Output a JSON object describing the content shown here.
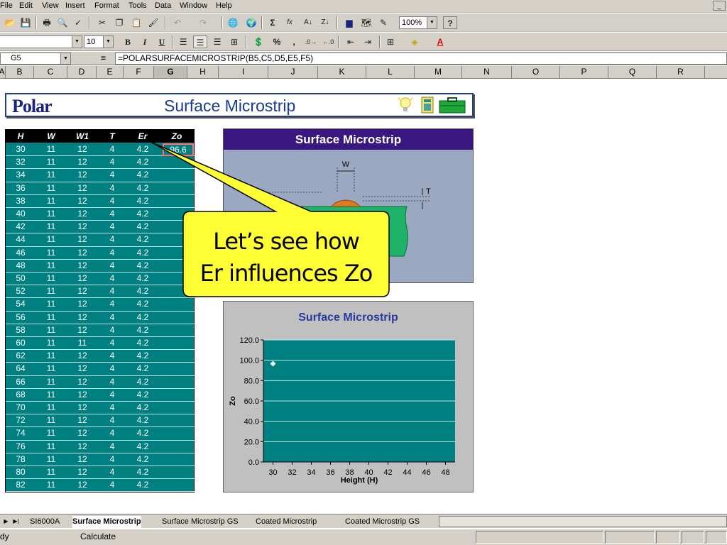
{
  "menu": [
    "File",
    "Edit",
    "View",
    "Insert",
    "Format",
    "Tools",
    "Data",
    "Window",
    "Help"
  ],
  "toolbar": {
    "zoom": "100%",
    "font_size": "10",
    "bold": "B",
    "italic": "I",
    "underline": "U",
    "autosum": "Σ",
    "fx": "fx",
    "percent": "%",
    "comma": ","
  },
  "formula_bar": {
    "cell_ref": "G5",
    "equals": "=",
    "formula": "=POLARSURFACEMICROSTRIP(B5,C5,D5,E5,F5)"
  },
  "columns": [
    "A",
    "B",
    "C",
    "D",
    "E",
    "F",
    "G",
    "H",
    "I",
    "J",
    "K",
    "L",
    "M",
    "N",
    "O",
    "P",
    "Q",
    "R"
  ],
  "selected_column": "G",
  "banner": {
    "logo": "Polar",
    "title": "Surface Microstrip"
  },
  "table": {
    "headers": [
      "H",
      "W",
      "W1",
      "T",
      "Er",
      "Zo"
    ],
    "rows": [
      [
        "30",
        "11",
        "12",
        "4",
        "4.2",
        "96.6"
      ],
      [
        "32",
        "11",
        "12",
        "4",
        "4.2",
        ""
      ],
      [
        "34",
        "11",
        "12",
        "4",
        "4.2",
        ""
      ],
      [
        "36",
        "11",
        "12",
        "4",
        "4.2",
        ""
      ],
      [
        "38",
        "11",
        "12",
        "4",
        "4.2",
        ""
      ],
      [
        "40",
        "11",
        "12",
        "4",
        "4.2",
        ""
      ],
      [
        "42",
        "11",
        "12",
        "4",
        "4.2",
        ""
      ],
      [
        "44",
        "11",
        "12",
        "4",
        "4.2",
        ""
      ],
      [
        "46",
        "11",
        "12",
        "4",
        "4.2",
        ""
      ],
      [
        "48",
        "11",
        "12",
        "4",
        "4.2",
        ""
      ],
      [
        "50",
        "11",
        "12",
        "4",
        "4.2",
        ""
      ],
      [
        "52",
        "11",
        "12",
        "4",
        "4.2",
        ""
      ],
      [
        "54",
        "11",
        "12",
        "4",
        "4.2",
        ""
      ],
      [
        "56",
        "11",
        "12",
        "4",
        "4.2",
        ""
      ],
      [
        "58",
        "11",
        "12",
        "4",
        "4.2",
        ""
      ],
      [
        "60",
        "11",
        "11",
        "4",
        "4.2",
        ""
      ],
      [
        "62",
        "11",
        "12",
        "4",
        "4.2",
        ""
      ],
      [
        "64",
        "11",
        "12",
        "4",
        "4.2",
        ""
      ],
      [
        "66",
        "11",
        "12",
        "4",
        "4.2",
        ""
      ],
      [
        "68",
        "11",
        "12",
        "4",
        "4.2",
        ""
      ],
      [
        "70",
        "11",
        "12",
        "4",
        "4.2",
        ""
      ],
      [
        "72",
        "11",
        "12",
        "4",
        "4.2",
        ""
      ],
      [
        "74",
        "11",
        "12",
        "4",
        "4.2",
        ""
      ],
      [
        "76",
        "11",
        "12",
        "4",
        "4.2",
        ""
      ],
      [
        "78",
        "11",
        "12",
        "4",
        "4.2",
        ""
      ],
      [
        "80",
        "11",
        "12",
        "4",
        "4.2",
        ""
      ],
      [
        "82",
        "11",
        "12",
        "4",
        "4.2",
        ""
      ]
    ]
  },
  "diagram": {
    "title": "Surface Microstrip",
    "label_w": "W",
    "label_t": "T"
  },
  "callout": {
    "line1": "Let’s see how",
    "line2": "Er influences Zo"
  },
  "chart_data": {
    "type": "scatter",
    "title": "Surface Microstrip",
    "xlabel": "Height (H)",
    "ylabel": "Zo",
    "xlim": [
      29,
      49
    ],
    "ylim": [
      0,
      120
    ],
    "xticks": [
      "30",
      "32",
      "34",
      "36",
      "38",
      "40",
      "42",
      "44",
      "46",
      "48"
    ],
    "yticks": [
      "0.0",
      "20.0",
      "40.0",
      "60.0",
      "80.0",
      "100.0",
      "120.0"
    ],
    "grid": true,
    "x": [
      30
    ],
    "y": [
      96.6
    ],
    "colors": {
      "plot_bg": "#008080",
      "point": "#ffffff",
      "grid": "#bfe6e6"
    }
  },
  "sheet_tabs": [
    "SI6000A",
    "Surface Microstrip",
    "Surface Microstrip GS",
    "Coated Microstrip",
    "Coated Microstrip GS"
  ],
  "active_tab": "Surface Microstrip",
  "status": {
    "left": "dy",
    "mode": "Calculate"
  }
}
